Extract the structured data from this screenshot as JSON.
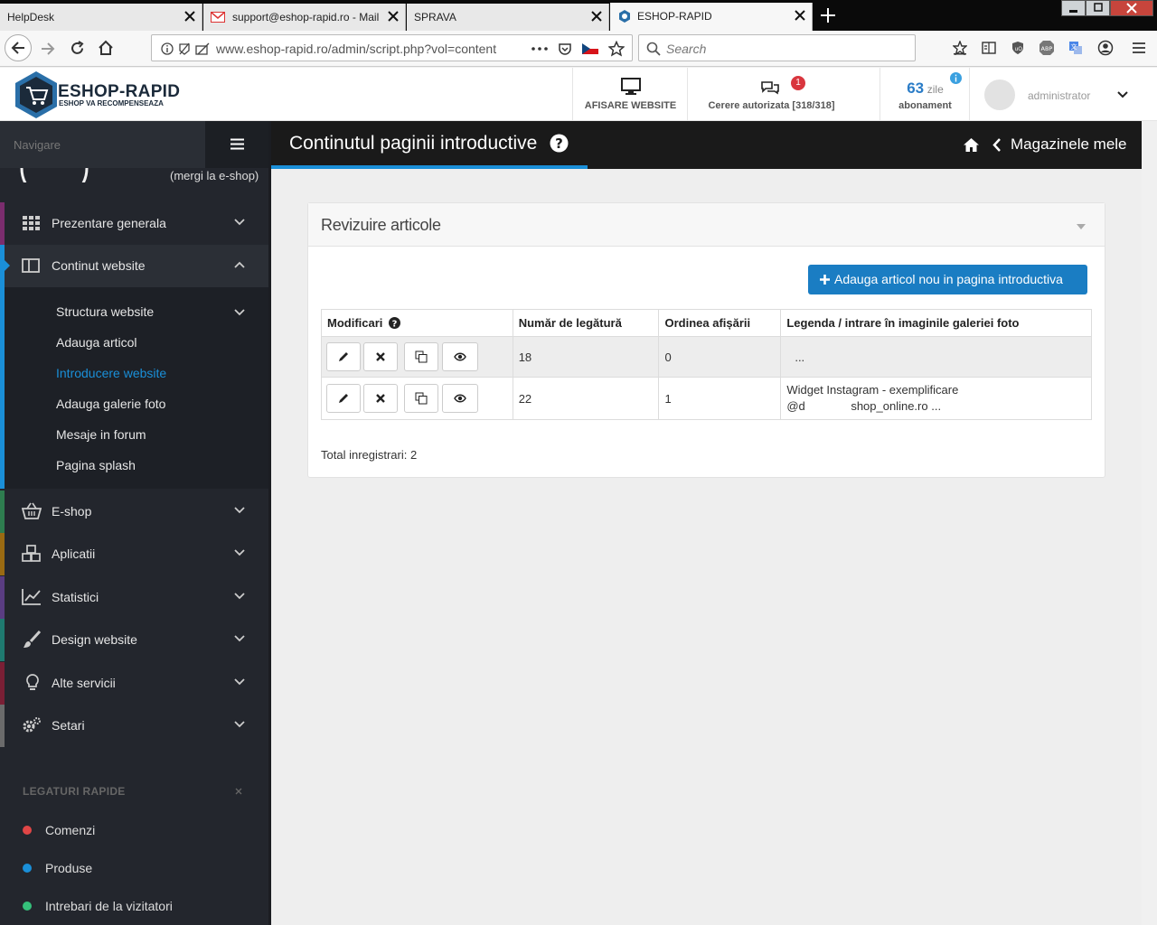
{
  "browser": {
    "tabs": [
      {
        "label": "HelpDesk"
      },
      {
        "label": "support@eshop-rapid.ro - Mail"
      },
      {
        "label": "SPRAVA"
      },
      {
        "label": "ESHOP-RAPID"
      }
    ],
    "url": "www.eshop-rapid.ro/admin/script.php?vol=content",
    "search_placeholder": "Search"
  },
  "header": {
    "logo_title": "ESHOP-RAPID",
    "logo_subtitle": "ESHOP VA RECOMPENSEAZA",
    "view_site_label": "AFISARE WEBSITE",
    "requests_label": "Cerere autorizata [318/318]",
    "requests_badge": "1",
    "days_value": "63",
    "days_unit": "zile",
    "subscription_label": "abonament",
    "user_name": "administrator"
  },
  "sidebar": {
    "nav_label": "Navigare",
    "eshop_link": "(mergi la e-shop)",
    "items": [
      {
        "label": "Prezentare generala",
        "color": "#7b2d6e"
      },
      {
        "label": "Continut website",
        "color": "#1a8fd8"
      },
      {
        "label": "E-shop",
        "color": "#2e7d4f"
      },
      {
        "label": "Aplicatii",
        "color": "#9a6a12"
      },
      {
        "label": "Statistici",
        "color": "#5a3d82"
      },
      {
        "label": "Design website",
        "color": "#1f7a70"
      },
      {
        "label": "Alte servicii",
        "color": "#7a1f35"
      },
      {
        "label": "Setari",
        "color": "#6b6b6b"
      }
    ],
    "submenu": [
      {
        "label": "Structura website"
      },
      {
        "label": "Adauga articol"
      },
      {
        "label": "Introducere website"
      },
      {
        "label": "Adauga galerie foto"
      },
      {
        "label": "Mesaje in forum"
      },
      {
        "label": "Pagina splash"
      }
    ],
    "quick_links_title": "LEGATURI RAPIDE",
    "quick_links": [
      {
        "label": "Comenzi",
        "color": "#e04646"
      },
      {
        "label": "Produse",
        "color": "#1a8fd8"
      },
      {
        "label": "Intrebari de la vizitatori",
        "color": "#35c07a"
      }
    ]
  },
  "page": {
    "title": "Continutul paginii introductive",
    "breadcrumb_back": "Magazinele mele"
  },
  "panel": {
    "title": "Revizuire articole",
    "add_button": "Adauga articol nou in pagina introductiva",
    "columns": [
      "Modificari",
      "Număr de legătură",
      "Ordinea afișării",
      "Legenda / intrare în imaginile galeriei foto"
    ],
    "rows": [
      {
        "link_no": "18",
        "order": "0",
        "legend_line1": "...",
        "legend_line2": ""
      },
      {
        "link_no": "22",
        "order": "1",
        "legend_line1": "Widget Instagram - exemplificare",
        "legend_line2": "@d              shop_online.ro ..."
      }
    ],
    "total": "Total inregistrari: 2"
  },
  "colors": {
    "accent": "#1a8fd8",
    "button": "#1a7dc3",
    "sidebar_bg": "#23262d",
    "titlebar_bg": "#1a1a1a"
  }
}
